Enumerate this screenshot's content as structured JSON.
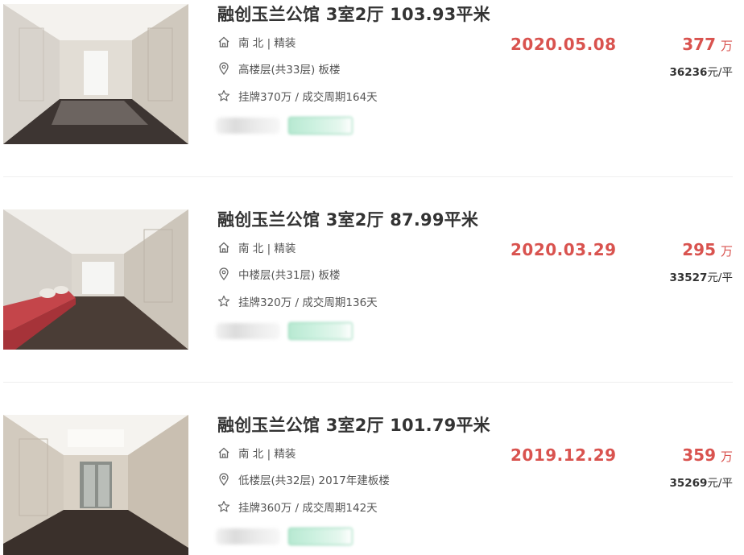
{
  "accent_color": "#d9534f",
  "listings": [
    {
      "title": "融创玉兰公馆 3室2厅 103.93平米",
      "house_info": "南 北 | 精装",
      "floor_info": "高楼层(共33层) 板楼",
      "deal_info": "挂牌370万 / 成交周期164天",
      "deal_date": "2020.05.08",
      "total_price": "377",
      "total_price_unit": "万",
      "unit_price": "36236",
      "unit_price_suffix": "元/平"
    },
    {
      "title": "融创玉兰公馆 3室2厅 87.99平米",
      "house_info": "南 北 | 精装",
      "floor_info": "中楼层(共31层) 板楼",
      "deal_info": "挂牌320万 / 成交周期136天",
      "deal_date": "2020.03.29",
      "total_price": "295",
      "total_price_unit": "万",
      "unit_price": "33527",
      "unit_price_suffix": "元/平"
    },
    {
      "title": "融创玉兰公馆 3室2厅 101.79平米",
      "house_info": "南 北 | 精装",
      "floor_info": "低楼层(共32层) 2017年建板楼",
      "deal_info": "挂牌360万 / 成交周期142天",
      "deal_date": "2019.12.29",
      "total_price": "359",
      "total_price_unit": "万",
      "unit_price": "35269",
      "unit_price_suffix": "元/平"
    }
  ]
}
